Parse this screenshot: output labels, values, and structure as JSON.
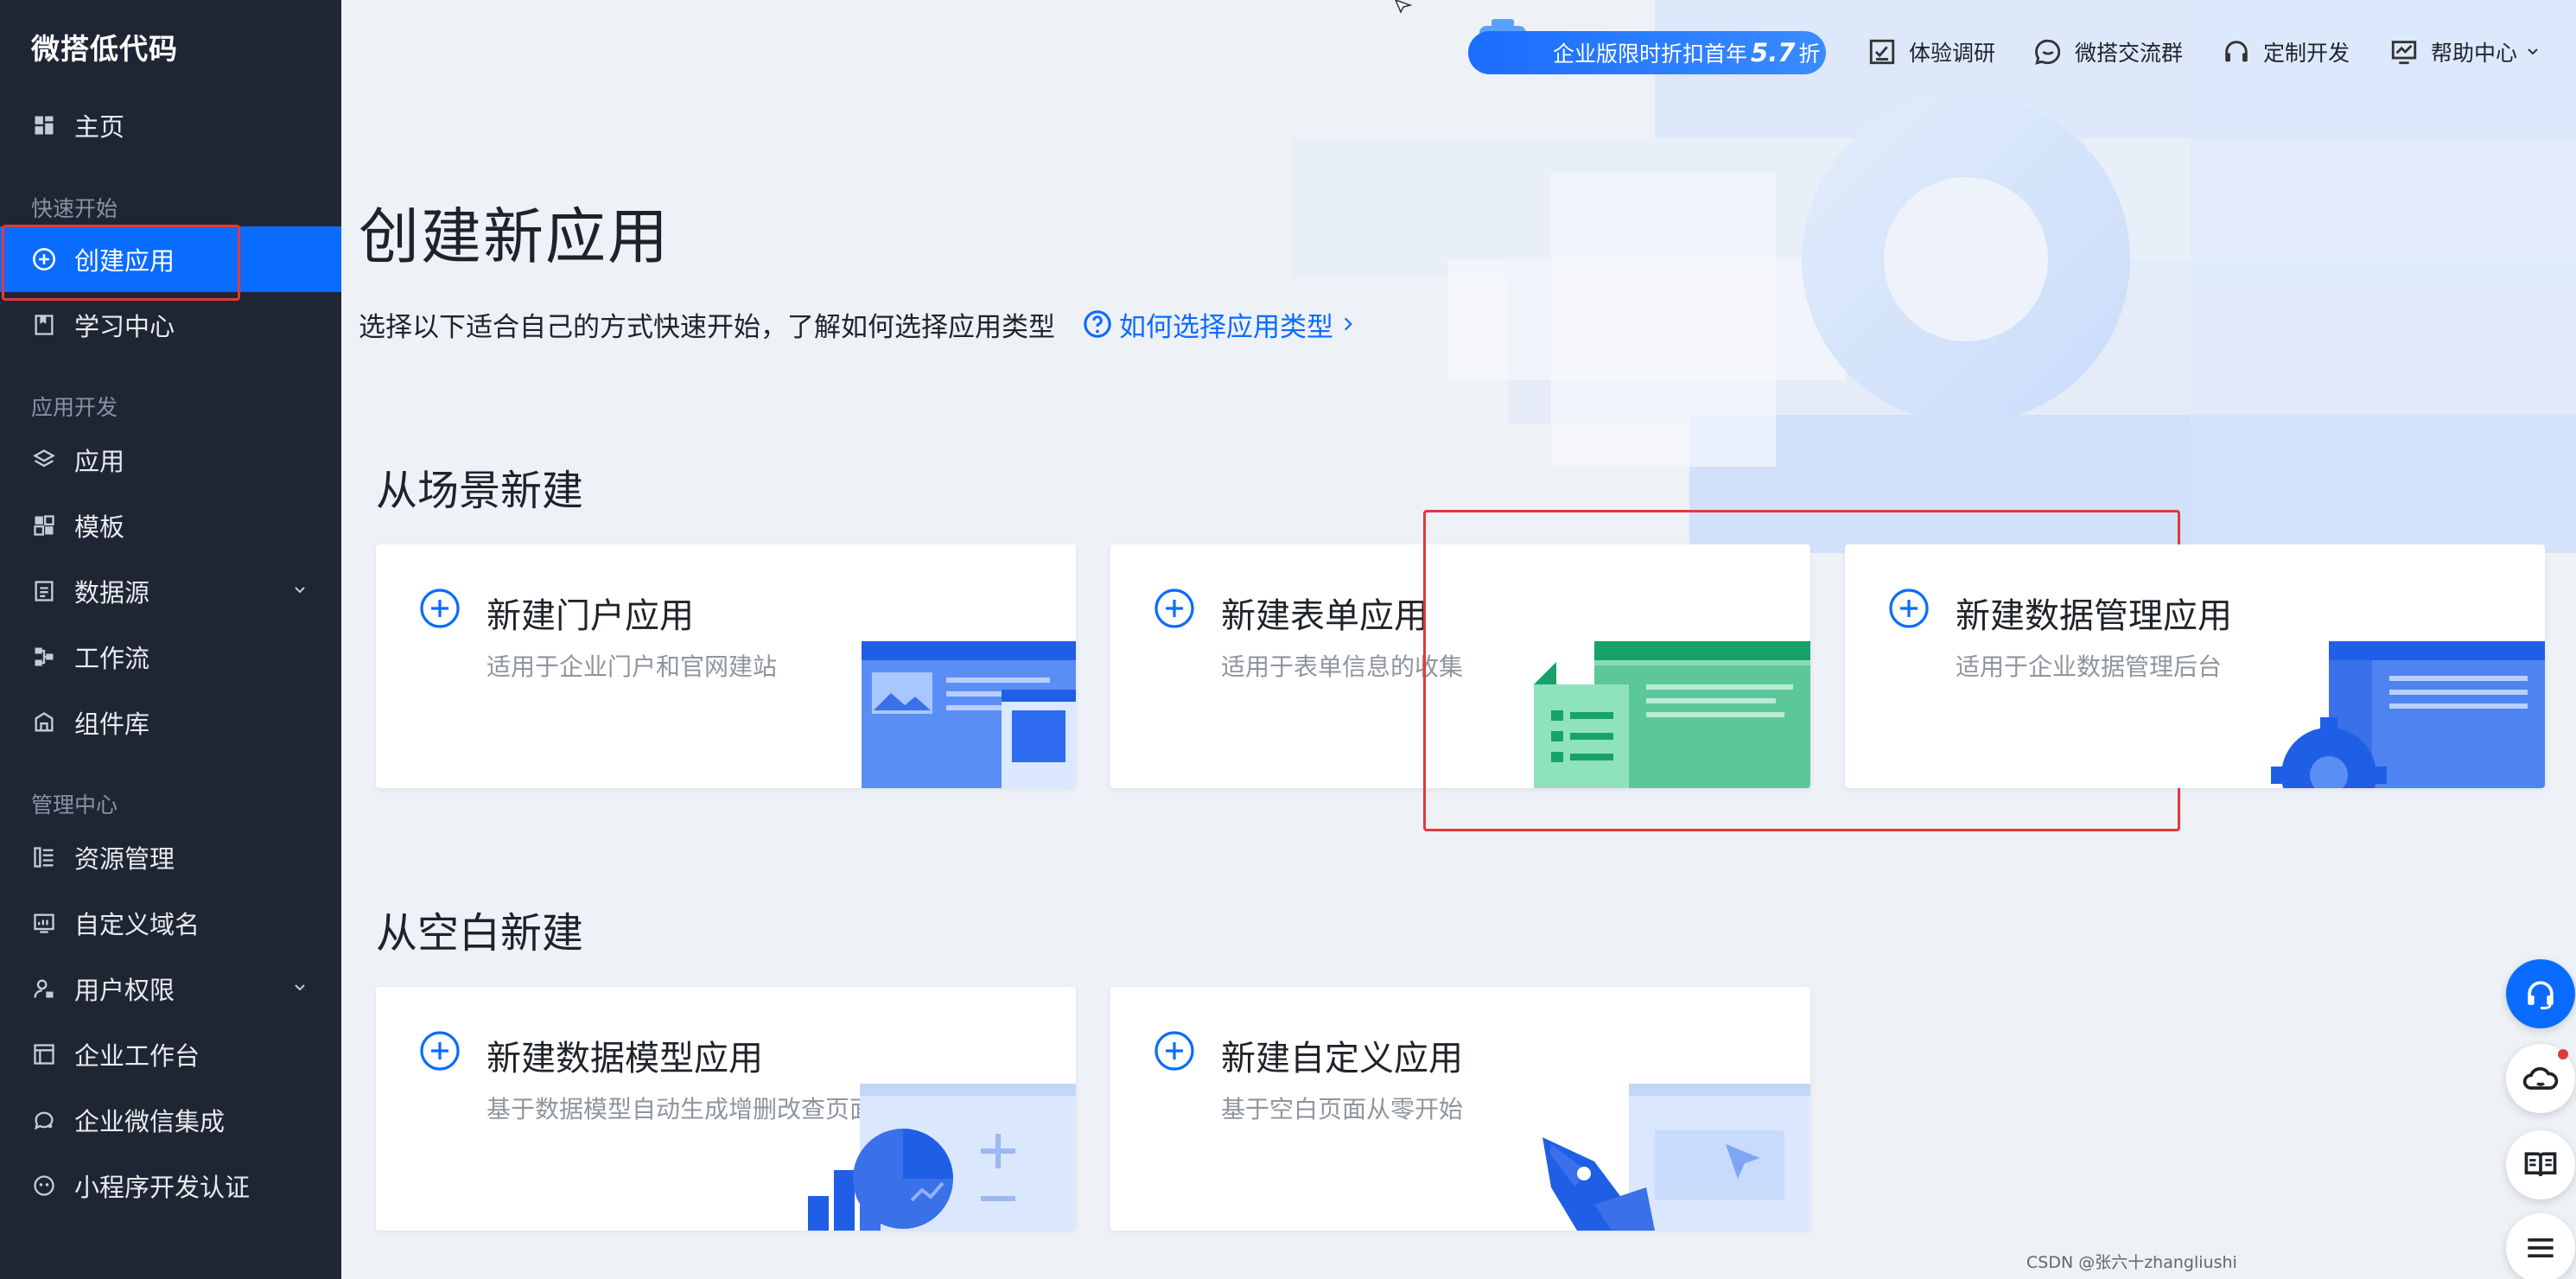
{
  "sidebar": {
    "brand": "微搭低代码",
    "home": "主页",
    "section_quickstart": "快速开始",
    "create_app": "创建应用",
    "learning": "学习中心",
    "section_dev": "应用开发",
    "apps": "应用",
    "templates": "模板",
    "datasource": "数据源",
    "workflow": "工作流",
    "components": "组件库",
    "section_admin": "管理中心",
    "resources": "资源管理",
    "custom_domain": "自定义域名",
    "permissions": "用户权限",
    "enterprise_workbench": "企业工作台",
    "wecom": "企业微信集成",
    "miniprogram": "小程序开发认证"
  },
  "topbar": {
    "promo_prefix": "企业版限时折扣首年",
    "promo_number": "5.7",
    "promo_suffix": "折",
    "survey": "体验调研",
    "community": "微搭交流群",
    "custom_dev": "定制开发",
    "help_center": "帮助中心"
  },
  "main": {
    "title": "创建新应用",
    "subtitle": "选择以下适合自己的方式快速开始，了解如何选择应用类型",
    "help_link": "如何选择应用类型",
    "section_scene": "从场景新建",
    "section_blank": "从空白新建"
  },
  "cards": {
    "portal": {
      "title": "新建门户应用",
      "desc": "适用于企业门户和官网建站"
    },
    "form": {
      "title": "新建表单应用",
      "desc": "适用于表单信息的收集"
    },
    "datamgmt": {
      "title": "新建数据管理应用",
      "desc": "适用于企业数据管理后台"
    },
    "datamodel": {
      "title": "新建数据模型应用",
      "desc": "基于数据模型自动生成增删改查页面"
    },
    "custom": {
      "title": "新建自定义应用",
      "desc": "基于空白页面从零开始"
    }
  },
  "watermark": "CSDN @张六十zhangliushi",
  "colors": {
    "sidebar_bg": "#1f2633",
    "accent": "#0a6cff",
    "highlight": "#e03a3a",
    "page_bg": "#eef1f6"
  }
}
